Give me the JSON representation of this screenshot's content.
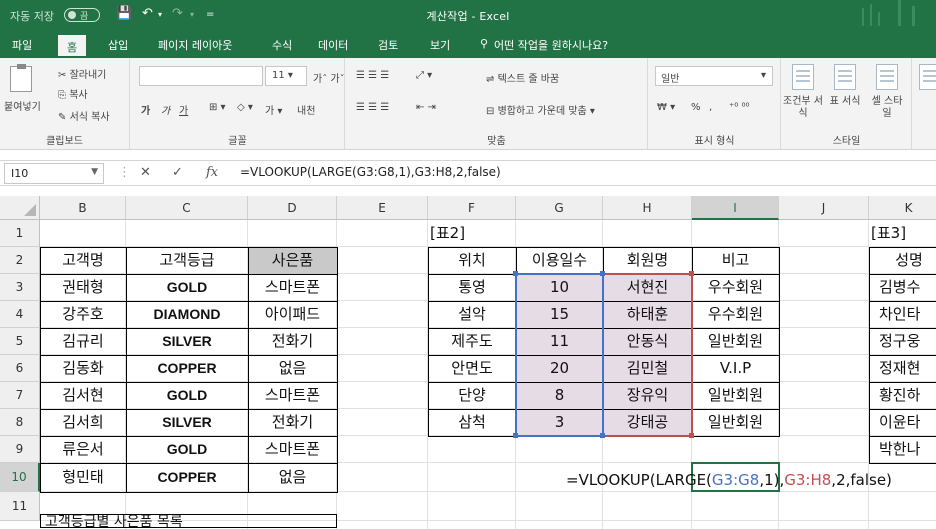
{
  "titlebar": {
    "autosave_label": "자동 저장",
    "autosave_state": "끔",
    "title": "계산작업 - Excel"
  },
  "menu": {
    "tabs": [
      "파일",
      "홈",
      "삽입",
      "페이지 레이아웃",
      "수식",
      "데이터",
      "검토",
      "보기"
    ],
    "active_tab": "홈",
    "tell_me": "어떤 작업을 원하시나요?"
  },
  "ribbon": {
    "clipboard": {
      "paste": "붙여넣기",
      "cut": "잘라내기",
      "copy": "복사",
      "format_painter": "서식 복사",
      "label": "클립보드"
    },
    "font": {
      "size": "11",
      "bold": "가",
      "italic": "가",
      "underline": "가",
      "phonetic": "내천",
      "label": "글꼴"
    },
    "alignment": {
      "wrap": "텍스트 줄 바꿈",
      "merge": "병합하고 가운데 맞춤",
      "label": "맞춤"
    },
    "number": {
      "format": "일반",
      "percent": "%",
      "comma": ",",
      "label": "표시 형식"
    },
    "styles": {
      "conditional": "조건부 서식",
      "table": "표 서식",
      "cell": "셀 스타일",
      "label": "스타일"
    }
  },
  "formula_bar": {
    "name_box": "I10",
    "formula": "=VLOOKUP(LARGE(G3:G8,1),G3:H8,2,false)"
  },
  "columns": [
    "B",
    "C",
    "D",
    "E",
    "F",
    "G",
    "H",
    "I",
    "J",
    "K"
  ],
  "rows": [
    "1",
    "2",
    "3",
    "4",
    "5",
    "6",
    "7",
    "8",
    "9",
    "10",
    "11"
  ],
  "table1": {
    "headers": [
      "고객명",
      "고객등급",
      "사은품"
    ],
    "rows": [
      [
        "권태형",
        "GOLD",
        "스마트폰"
      ],
      [
        "강주호",
        "DIAMOND",
        "아이패드"
      ],
      [
        "김규리",
        "SILVER",
        "전화기"
      ],
      [
        "김동화",
        "COPPER",
        "없음"
      ],
      [
        "김서현",
        "GOLD",
        "스마트폰"
      ],
      [
        "김서희",
        "SILVER",
        "전화기"
      ],
      [
        "류은서",
        "GOLD",
        "스마트폰"
      ],
      [
        "형민태",
        "COPPER",
        "없음"
      ]
    ],
    "caption": "고객등급별 사은품 목록"
  },
  "table2": {
    "label": "[표2]",
    "headers": [
      "위치",
      "이용일수",
      "회원명",
      "비고"
    ],
    "rows": [
      [
        "통영",
        "10",
        "서현진",
        "우수회원"
      ],
      [
        "설악",
        "15",
        "하태훈",
        "우수회원"
      ],
      [
        "제주도",
        "11",
        "안동식",
        "일반회원"
      ],
      [
        "안면도",
        "20",
        "김민철",
        "V.I.P"
      ],
      [
        "단양",
        "8",
        "장유익",
        "일반회원"
      ],
      [
        "삼척",
        "3",
        "강태공",
        "일반회원"
      ]
    ]
  },
  "table3": {
    "label": "[표3]",
    "header": "성명",
    "rows": [
      "김병수",
      "차인타",
      "정구웅",
      "정재현",
      "황진하",
      "이윤타",
      "박한나"
    ]
  },
  "edit_formula": {
    "prefix": "=VLOOKUP(LARGE(",
    "ref1": "G3:G8",
    "mid": ",1),",
    "ref2": "G3:H8",
    "suffix": ",2,false)"
  },
  "colors": {
    "excel_green": "#217346",
    "ref_blue": "#4472c4",
    "ref_red": "#c0504d",
    "selected_range_fill": "#e6dce6",
    "header_gray": "#c9c9c9"
  }
}
